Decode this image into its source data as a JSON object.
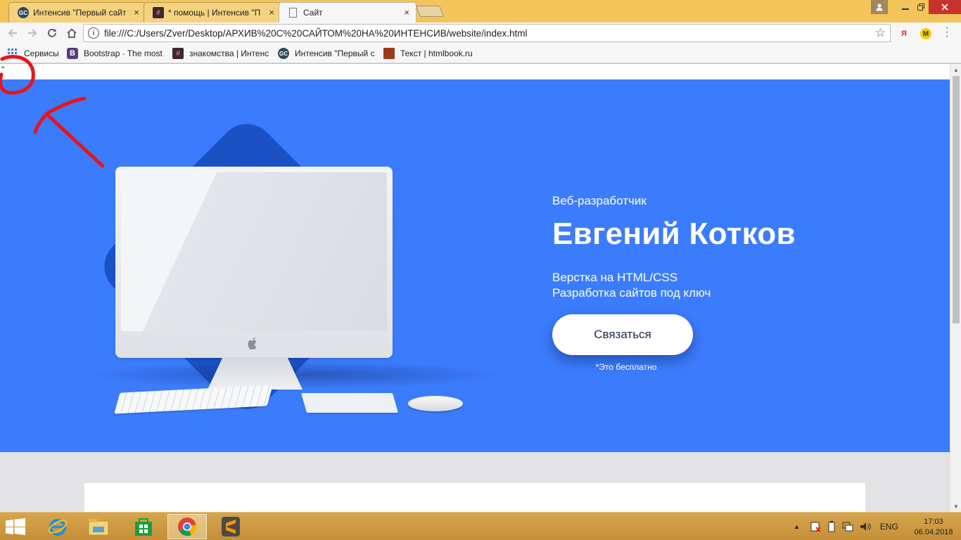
{
  "browser": {
    "tabs": [
      {
        "title": "Интенсив \"Первый сайт",
        "icon": "gc-favicon"
      },
      {
        "title": "* помощь | Интенсив \"П",
        "icon": "hashtag-favicon"
      },
      {
        "title": "Сайт",
        "icon": "document-favicon",
        "active": true
      }
    ],
    "close_glyph": "×",
    "url": "file:///C:/Users/Zver/Desktop/АРХИВ%20С%20САЙТОМ%20НА%20ИНТЕНСИВ/website/index.html",
    "info_glyph": "i",
    "extensions": [
      {
        "name": "yandex-icon",
        "label": "Я"
      },
      {
        "name": "metro-icon",
        "label": "M"
      }
    ]
  },
  "bookmarks": [
    {
      "label": "Сервисы",
      "icon": "apps-icon"
    },
    {
      "label": "Bootstrap · The most",
      "icon": "bootstrap-icon"
    },
    {
      "label": "знакомства | Интенс",
      "icon": "hashtag-icon"
    },
    {
      "label": "Интенсив \"Первый с",
      "icon": "gc-icon"
    },
    {
      "label": "Текст | htmlbook.ru",
      "icon": "htmlbook-icon"
    }
  ],
  "page": {
    "stray_char": "\"",
    "hero": {
      "subtitle": "Веб-разработчик",
      "name": "Евгений Котков",
      "desc_line1": "Верстка на HTML/CSS",
      "desc_line2": "Разработка сайтов под ключ",
      "cta_label": "Связаться",
      "free_note": "*Это бесплатно"
    },
    "colors": {
      "hero_bg": "#3b7cfd",
      "diamond": "#1a52c5",
      "annotation": "#e8141b"
    }
  },
  "taskbar": {
    "lang": "ENG",
    "time": "17:03",
    "date": "06.04.2018",
    "apps": [
      "ie-icon",
      "file-explorer-icon",
      "store-icon",
      "chrome-icon",
      "sublime-icon"
    ]
  }
}
